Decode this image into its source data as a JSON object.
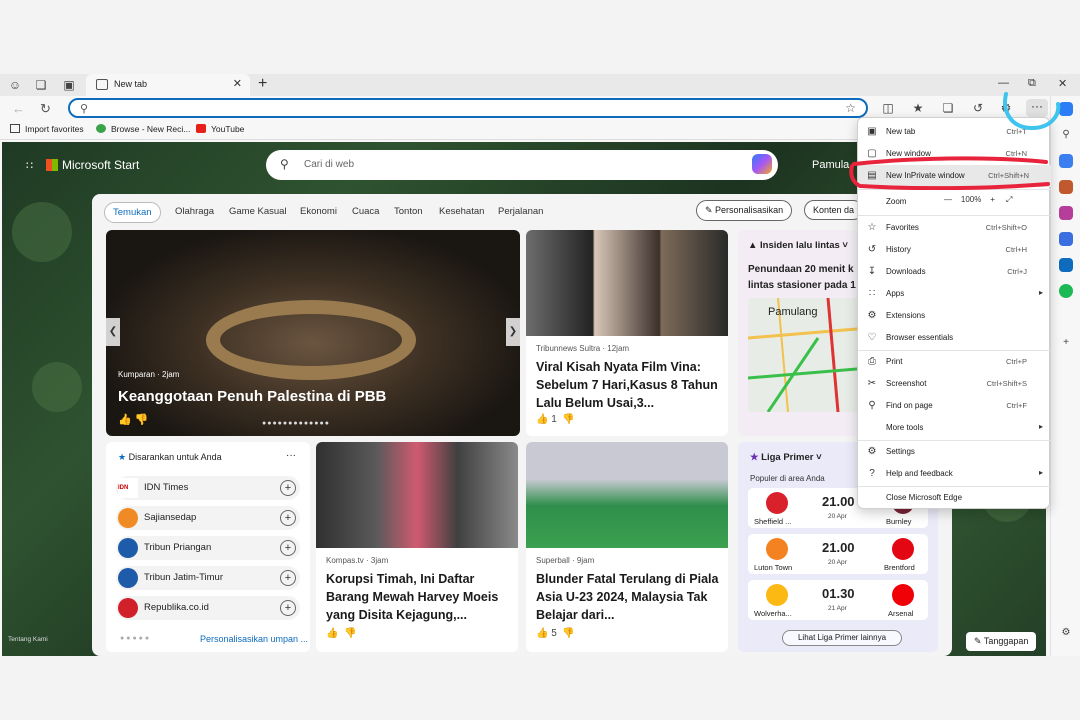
{
  "tab": {
    "title": "New tab"
  },
  "omnibox": {
    "value": ""
  },
  "favorites": [
    {
      "label": "Import favorites"
    },
    {
      "label": "Browse - New Reci..."
    },
    {
      "label": "YouTube"
    }
  ],
  "header": {
    "brand": "Microsoft Start",
    "search_placeholder": "Cari di web",
    "user": "Pamula"
  },
  "categories": [
    "Temukan",
    "Olahraga",
    "Game Kasual",
    "Ekonomi",
    "Cuaca",
    "Tonton",
    "Kesehatan",
    "Perjalanan"
  ],
  "personalize_label": "Personalisasikan",
  "content_label": "Konten da",
  "hero": {
    "source": "Kumparan · 2jam",
    "title": "Keanggotaan Penuh Palestina di PBB"
  },
  "news": [
    {
      "source": "Tribunnews Sultra · 12jam",
      "title": "Viral Kisah Nyata Film Vina: Sebelum 7 Hari,Kasus 8 Tahun Lalu Belum Usai,3...",
      "likes": "1"
    },
    {
      "source": "Kompas.tv · 3jam",
      "title": "Korupsi Timah, Ini Daftar Barang Mewah Harvey Moeis yang Disita Kejagung,...",
      "likes": ""
    },
    {
      "source": "Superball · 9jam",
      "title": "Blunder Fatal Terulang di Piala Asia U-23 2024, Malaysia Tak Belajar dari...",
      "likes": "5"
    }
  ],
  "insiden": {
    "heading": "Insiden lalu lintas",
    "text": "Penundaan 20 menit k lintas stasioner pada 1",
    "map_label": "Pamulang"
  },
  "suggest": {
    "heading": "Disarankan untuk Anda",
    "items": [
      "IDN Times",
      "Sajiansedap",
      "Tribun Priangan",
      "Tribun Jatim-Timur",
      "Republika.co.id"
    ],
    "footer": "Personalisasikan umpan ..."
  },
  "liga": {
    "heading": "Liga Primer",
    "sub": "Populer di area Anda",
    "matches": [
      {
        "home": "Sheffield ...",
        "away": "Burnley",
        "time": "21.00",
        "date": "20 Apr"
      },
      {
        "home": "Luton Town",
        "away": "Brentford",
        "time": "21.00",
        "date": "20 Apr"
      },
      {
        "home": "Wolverha...",
        "away": "Arsenal",
        "time": "01.30",
        "date": "21 Apr"
      }
    ],
    "button": "Lihat Liga Primer lainnya"
  },
  "footer": {
    "about": "Tentang Kami",
    "feedback": "Tanggapan"
  },
  "menu": {
    "items": [
      {
        "label": "New tab",
        "shortcut": "Ctrl+T",
        "icon": "new-tab-icon"
      },
      {
        "label": "New window",
        "shortcut": "Ctrl+N",
        "icon": "new-window-icon"
      },
      {
        "label": "New InPrivate window",
        "shortcut": "Ctrl+Shift+N",
        "icon": "inprivate-icon"
      },
      {
        "label": "Zoom",
        "shortcut": "",
        "icon": ""
      },
      {
        "label": "Favorites",
        "shortcut": "Ctrl+Shift+O",
        "icon": "favorites-icon"
      },
      {
        "label": "History",
        "shortcut": "Ctrl+H",
        "icon": "history-icon"
      },
      {
        "label": "Downloads",
        "shortcut": "Ctrl+J",
        "icon": "downloads-icon"
      },
      {
        "label": "Apps",
        "shortcut": "",
        "icon": "apps-icon"
      },
      {
        "label": "Extensions",
        "shortcut": "",
        "icon": "extensions-icon"
      },
      {
        "label": "Browser essentials",
        "shortcut": "",
        "icon": "heart-icon"
      },
      {
        "label": "Print",
        "shortcut": "Ctrl+P",
        "icon": "print-icon"
      },
      {
        "label": "Screenshot",
        "shortcut": "Ctrl+Shift+S",
        "icon": "screenshot-icon"
      },
      {
        "label": "Find on page",
        "shortcut": "Ctrl+F",
        "icon": "find-icon"
      },
      {
        "label": "More tools",
        "shortcut": "",
        "icon": ""
      },
      {
        "label": "Settings",
        "shortcut": "",
        "icon": "gear-icon"
      },
      {
        "label": "Help and feedback",
        "shortcut": "",
        "icon": "help-icon"
      },
      {
        "label": "Close Microsoft Edge",
        "shortcut": "",
        "icon": ""
      }
    ],
    "zoom_value": "100%"
  },
  "colors": {
    "accent": "#0f6cbd",
    "annotation_red": "#e8243c",
    "annotation_blue": "#3fc4ee"
  }
}
